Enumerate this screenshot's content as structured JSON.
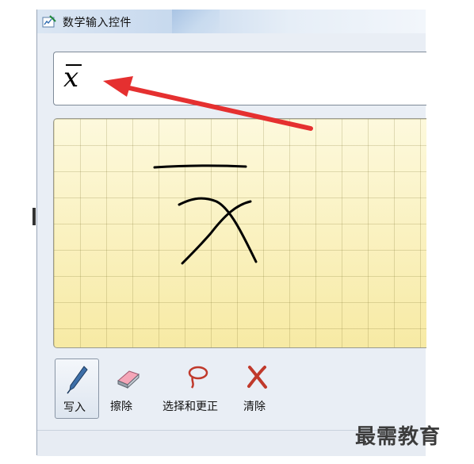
{
  "window": {
    "title": "数学输入控件"
  },
  "output": {
    "expression": "x̄",
    "letter": "x"
  },
  "toolbar": {
    "write_label": "写入",
    "erase_label": "擦除",
    "select_correct_label": "选择和更正",
    "clear_label": "清除"
  },
  "watermark": "最需教育",
  "colors": {
    "pad_background": "#fbf5c8",
    "annotation_arrow": "#e53030",
    "ink": "#000000"
  },
  "icons": [
    "pen-icon",
    "eraser-icon",
    "lasso-icon",
    "clear-x-icon",
    "math-input-app-icon"
  ]
}
